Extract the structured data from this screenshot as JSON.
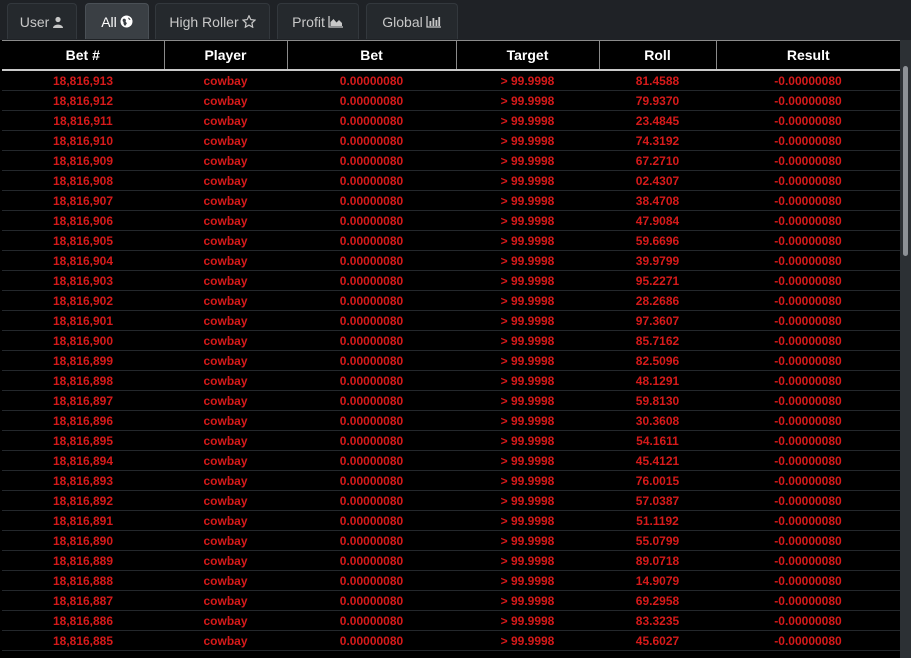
{
  "tabs": [
    {
      "label": "User",
      "icon": "user-icon",
      "active": false
    },
    {
      "label": "All",
      "icon": "globe-icon",
      "active": true
    },
    {
      "label": "High Roller",
      "icon": "star-icon",
      "active": false
    },
    {
      "label": "Profit",
      "icon": "area-chart-icon",
      "active": false
    },
    {
      "label": "Global",
      "icon": "bar-chart-icon",
      "active": false
    }
  ],
  "table": {
    "headers": [
      "Bet #",
      "Player",
      "Bet",
      "Target",
      "Roll",
      "Result"
    ],
    "rows": [
      [
        "18,816,913",
        "cowbay",
        "0.00000080",
        "> 99.9998",
        "81.4588",
        "-0.00000080"
      ],
      [
        "18,816,912",
        "cowbay",
        "0.00000080",
        "> 99.9998",
        "79.9370",
        "-0.00000080"
      ],
      [
        "18,816,911",
        "cowbay",
        "0.00000080",
        "> 99.9998",
        "23.4845",
        "-0.00000080"
      ],
      [
        "18,816,910",
        "cowbay",
        "0.00000080",
        "> 99.9998",
        "74.3192",
        "-0.00000080"
      ],
      [
        "18,816,909",
        "cowbay",
        "0.00000080",
        "> 99.9998",
        "67.2710",
        "-0.00000080"
      ],
      [
        "18,816,908",
        "cowbay",
        "0.00000080",
        "> 99.9998",
        "02.4307",
        "-0.00000080"
      ],
      [
        "18,816,907",
        "cowbay",
        "0.00000080",
        "> 99.9998",
        "38.4708",
        "-0.00000080"
      ],
      [
        "18,816,906",
        "cowbay",
        "0.00000080",
        "> 99.9998",
        "47.9084",
        "-0.00000080"
      ],
      [
        "18,816,905",
        "cowbay",
        "0.00000080",
        "> 99.9998",
        "59.6696",
        "-0.00000080"
      ],
      [
        "18,816,904",
        "cowbay",
        "0.00000080",
        "> 99.9998",
        "39.9799",
        "-0.00000080"
      ],
      [
        "18,816,903",
        "cowbay",
        "0.00000080",
        "> 99.9998",
        "95.2271",
        "-0.00000080"
      ],
      [
        "18,816,902",
        "cowbay",
        "0.00000080",
        "> 99.9998",
        "28.2686",
        "-0.00000080"
      ],
      [
        "18,816,901",
        "cowbay",
        "0.00000080",
        "> 99.9998",
        "97.3607",
        "-0.00000080"
      ],
      [
        "18,816,900",
        "cowbay",
        "0.00000080",
        "> 99.9998",
        "85.7162",
        "-0.00000080"
      ],
      [
        "18,816,899",
        "cowbay",
        "0.00000080",
        "> 99.9998",
        "82.5096",
        "-0.00000080"
      ],
      [
        "18,816,898",
        "cowbay",
        "0.00000080",
        "> 99.9998",
        "48.1291",
        "-0.00000080"
      ],
      [
        "18,816,897",
        "cowbay",
        "0.00000080",
        "> 99.9998",
        "59.8130",
        "-0.00000080"
      ],
      [
        "18,816,896",
        "cowbay",
        "0.00000080",
        "> 99.9998",
        "30.3608",
        "-0.00000080"
      ],
      [
        "18,816,895",
        "cowbay",
        "0.00000080",
        "> 99.9998",
        "54.1611",
        "-0.00000080"
      ],
      [
        "18,816,894",
        "cowbay",
        "0.00000080",
        "> 99.9998",
        "45.4121",
        "-0.00000080"
      ],
      [
        "18,816,893",
        "cowbay",
        "0.00000080",
        "> 99.9998",
        "76.0015",
        "-0.00000080"
      ],
      [
        "18,816,892",
        "cowbay",
        "0.00000080",
        "> 99.9998",
        "57.0387",
        "-0.00000080"
      ],
      [
        "18,816,891",
        "cowbay",
        "0.00000080",
        "> 99.9998",
        "51.1192",
        "-0.00000080"
      ],
      [
        "18,816,890",
        "cowbay",
        "0.00000080",
        "> 99.9998",
        "55.0799",
        "-0.00000080"
      ],
      [
        "18,816,889",
        "cowbay",
        "0.00000080",
        "> 99.9998",
        "89.0718",
        "-0.00000080"
      ],
      [
        "18,816,888",
        "cowbay",
        "0.00000080",
        "> 99.9998",
        "14.9079",
        "-0.00000080"
      ],
      [
        "18,816,887",
        "cowbay",
        "0.00000080",
        "> 99.9998",
        "69.2958",
        "-0.00000080"
      ],
      [
        "18,816,886",
        "cowbay",
        "0.00000080",
        "> 99.9998",
        "83.3235",
        "-0.00000080"
      ],
      [
        "18,816,885",
        "cowbay",
        "0.00000080",
        "> 99.9998",
        "45.6027",
        "-0.00000080"
      ]
    ]
  },
  "colors": {
    "background": "#000000",
    "row_text": "#d61a1a",
    "header_text": "#ffffff",
    "active_tab": "#3a3f44"
  }
}
